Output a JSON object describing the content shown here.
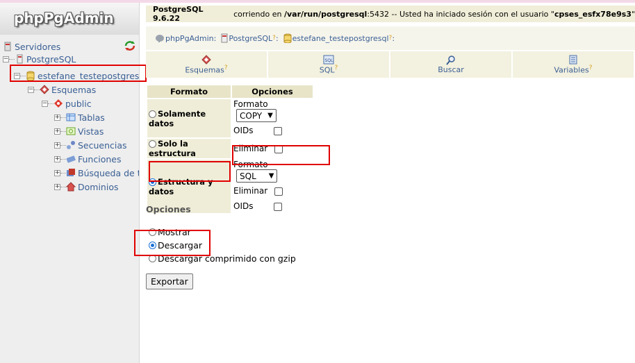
{
  "app": {
    "logo": "phpPgAdmin"
  },
  "tree": {
    "servers": "Servidores",
    "server": "PostgreSQL",
    "database": "estefane_testepostgresql",
    "schemas": "Esquemas",
    "schema": "public",
    "children": [
      "Tablas",
      "Vistas",
      "Secuencias",
      "Funciones",
      "Búsqueda de texto completo",
      "Dominios"
    ]
  },
  "topbar": {
    "prefix": "PostgreSQL 9.6.22",
    "mid1": " corriendo en ",
    "host": "/var/run/postgresql",
    "mid2": ":5432 -- Usted ha iniciado sesión con el usuario \"",
    "user": "cpses_esfx78e9s3",
    "end": "\""
  },
  "breadcrumb": {
    "app": "phpPgAdmin:",
    "server": "PostgreSQL",
    "database": "estefane_testepostgresql"
  },
  "tabs": [
    {
      "label": "Esquemas",
      "help": "?"
    },
    {
      "label": "SQL",
      "help": "?"
    },
    {
      "label": "Buscar",
      "help": ""
    },
    {
      "label": "Variables",
      "help": "?"
    }
  ],
  "export_table": {
    "header_format": "Formato",
    "header_options": "Opciones",
    "data_only": "Solamente datos",
    "structure_only": "Solo la estructura",
    "structure_and_data": "Estructura y datos",
    "format_label": "Formato",
    "oids_label": "OIDs",
    "drop_label": "Eliminar",
    "data_format_value": "COPY",
    "sd_format_value": "SQL"
  },
  "output": {
    "title": "Opciones",
    "show": "Mostrar",
    "download": "Descargar",
    "download_gzip": "Descargar comprimido con gzip"
  },
  "export_button": "Exportar",
  "colors": {
    "accent_red": "#e00000",
    "link": "#3a5f94",
    "bar": "#f0eed8"
  }
}
